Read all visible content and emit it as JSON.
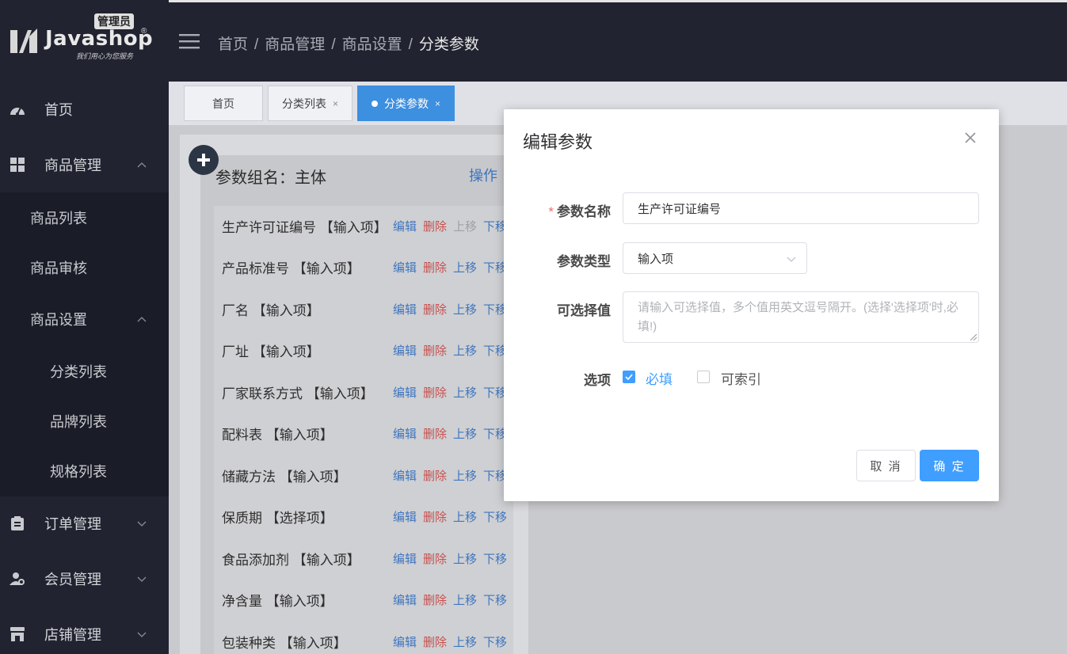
{
  "logo": {
    "brand": "Javashop",
    "reg": "®",
    "badge": "管理员",
    "slogan": "我们用心为您服务"
  },
  "sidebar": {
    "items": [
      {
        "label": "首页",
        "icon": "dashboard-icon"
      },
      {
        "label": "商品管理",
        "icon": "grid-icon"
      },
      {
        "label": "订单管理",
        "icon": "clipboard-icon"
      },
      {
        "label": "会员管理",
        "icon": "member-icon"
      },
      {
        "label": "店铺管理",
        "icon": "store-icon"
      }
    ],
    "goods_sub": [
      "商品列表",
      "商品审核",
      "商品设置"
    ],
    "settings_sub": [
      "分类列表",
      "品牌列表",
      "规格列表"
    ]
  },
  "header": {
    "breadcrumb": [
      "首页",
      "商品管理",
      "商品设置",
      "分类参数"
    ],
    "separator": "/"
  },
  "tabs": [
    {
      "label": "首页",
      "closable": false
    },
    {
      "label": "分类列表",
      "close": "×"
    },
    {
      "label": "分类参数",
      "close": "×"
    }
  ],
  "card": {
    "title": "参数组名：主体",
    "op": "操作",
    "actions": {
      "edit": "编辑",
      "delete": "删除",
      "up": "上移",
      "down": "下移"
    },
    "rows": [
      "生产许可证编号 【输入项】",
      "产品标准号 【输入项】",
      "厂名 【输入项】",
      "厂址 【输入项】",
      "厂家联系方式 【输入项】",
      "配料表 【输入项】",
      "储藏方法 【输入项】",
      "保质期 【选择项】",
      "食品添加剂 【输入项】",
      "净含量 【输入项】",
      "包装种类 【输入项】"
    ]
  },
  "modal": {
    "title": "编辑参数",
    "required_mark": "*",
    "name_label": "参数名称",
    "name_value": "生产许可证编号",
    "type_label": "参数类型",
    "type_value": "输入项",
    "options_label": "可选择值",
    "options_placeholder": "请输入可选择值，多个值用英文逗号隔开。(选择'选择项'时,必填!)",
    "choice_label": "选项",
    "required_option": "必填",
    "indexable_option": "可索引",
    "cancel": "取 消",
    "ok": "确 定"
  },
  "colors": {
    "accent": "#409eff",
    "sidebar": "#212330",
    "danger": "#c7504f"
  }
}
